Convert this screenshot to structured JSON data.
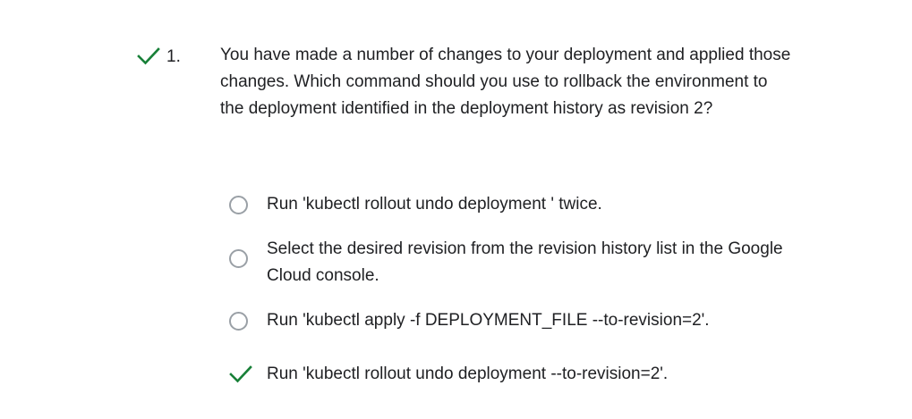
{
  "question": {
    "status_icon": "checkmark-icon",
    "number": "1.",
    "text": "You have made a number of changes to your deployment and applied those changes. Which command should you use to rollback the environment to the deployment identified in the deployment history as revision 2?"
  },
  "options": [
    {
      "label": "Run 'kubectl rollout undo deployment ' twice.",
      "state": "unselected"
    },
    {
      "label": "Select the desired revision from the revision history list in the Google Cloud console.",
      "state": "unselected"
    },
    {
      "label": "Run 'kubectl apply -f DEPLOYMENT_FILE --to-revision=2'.",
      "state": "unselected"
    },
    {
      "label": "Run 'kubectl rollout undo deployment --to-revision=2'.",
      "state": "correct"
    }
  ],
  "colors": {
    "correct": "#188038",
    "radio_border": "#9aa0a6",
    "text": "#202124"
  }
}
